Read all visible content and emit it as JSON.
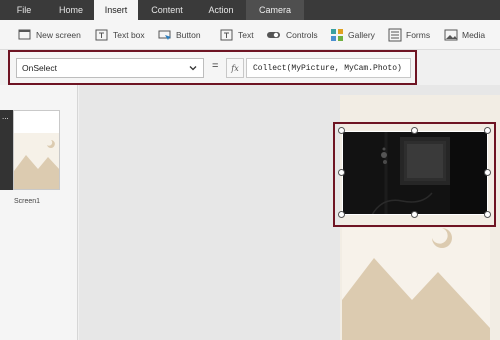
{
  "menu": {
    "tabs": [
      "File",
      "Home",
      "Insert",
      "Content",
      "Action",
      "Camera"
    ],
    "active": "Insert"
  },
  "ribbon": {
    "items": [
      {
        "label": "New screen",
        "icon": "new-screen-icon"
      },
      {
        "label": "Text box",
        "icon": "text-box-icon"
      },
      {
        "label": "Button",
        "icon": "button-icon"
      },
      {
        "label": "Text",
        "icon": "text-icon"
      },
      {
        "label": "Controls",
        "icon": "controls-icon"
      },
      {
        "label": "Gallery",
        "icon": "gallery-icon"
      },
      {
        "label": "Forms",
        "icon": "forms-icon"
      },
      {
        "label": "Media",
        "icon": "media-icon"
      }
    ]
  },
  "formula": {
    "property": "OnSelect",
    "equals": "=",
    "fx": "fx",
    "expression": "Collect(MyPicture, MyCam.Photo)"
  },
  "screens": {
    "items": [
      {
        "label": "Screen1",
        "dots": "..."
      }
    ]
  },
  "colors": {
    "menubar_bg": "#3a3a3a",
    "highlight_border": "#6e1423",
    "placeholder_mountain": "#dccbb0"
  }
}
